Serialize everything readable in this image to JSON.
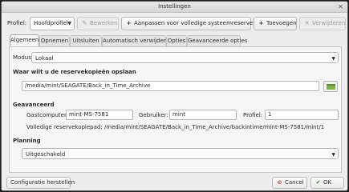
{
  "window": {
    "title": "Instellingen",
    "close_glyph": "✕"
  },
  "toolbar": {
    "profile_label": "Profiel:",
    "profile_value": "Hoofdprofiel",
    "edit_label": "Bewerken",
    "adjust_label": "Aanpassen voor volledige systeemreservekopie",
    "add_label": "Toevoegen",
    "remove_label": "Verwijderen"
  },
  "tabs": [
    "Algemeen",
    "Opnemen",
    "Uitsluiten",
    "Automatisch verwijderen",
    "Opties",
    "Geavanceerde opties"
  ],
  "general": {
    "mode_label": "Modus:",
    "mode_value": "Lokaal",
    "where_title": "Waar wilt u de reservekopieën opslaan",
    "where_path": "/media/mint/SEAGATE/Back_in_Time_Archive",
    "advanced_title": "Geavanceerd",
    "host_label": "Gastcomputer:",
    "host_value": "mint-MS-7581",
    "user_label": "Gebruiker:",
    "user_value": "mint",
    "profile_label": "Profiel:",
    "profile_value": "1",
    "full_path_text": "Volledige reservekopiepad: /media/mint/SEAGATE/Back_in_Time_Archive/backintime/mint-MS-7581/mint/1",
    "schedule_title": "Planning",
    "schedule_value": "Uitgeschakeld"
  },
  "footer": {
    "restore_label": "Configuratie herstellen",
    "cancel_label": "Cancel",
    "ok_label": "OK"
  },
  "colors": {
    "folder_icon": "#7cb342",
    "window_bg": "#ededed"
  }
}
